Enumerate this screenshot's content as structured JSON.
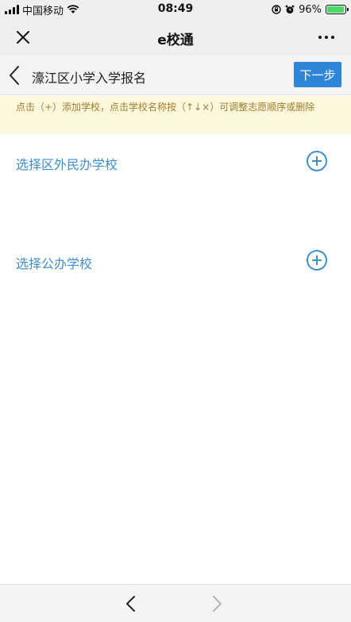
{
  "status_bar": {
    "carrier": "中国移动",
    "time": "08:49",
    "battery": "96%",
    "battery_level": 0.96,
    "icons": [
      "signal-icon",
      "wifi-icon",
      "orientation-lock-icon",
      "alarm-icon",
      "battery-icon"
    ]
  },
  "title_bar": {
    "title": "e校通",
    "close_icon": "close-icon",
    "more_icon": "more-icon"
  },
  "nav": {
    "title": "濠江区小学入学报名",
    "next_label": "下一步",
    "back_icon": "chevron-left-icon"
  },
  "hint": {
    "text": "点击（+）添加学校，点击学校名称按（↑↓×）可调整志愿顺序或删除"
  },
  "sections": [
    {
      "label": "选择区外民办学校",
      "add_icon": "add-circle-icon"
    },
    {
      "label": "选择公办学校",
      "add_icon": "add-circle-icon"
    }
  ],
  "bottom_nav": {
    "back_icon": "chevron-left-icon",
    "forward_icon": "chevron-right-icon"
  },
  "colors": {
    "accent": "#2f86d8",
    "link": "#3d8fd3",
    "hint_bg": "#fdf8dc",
    "hint_text": "#9e7b33",
    "bar_bg": "#efefef"
  }
}
